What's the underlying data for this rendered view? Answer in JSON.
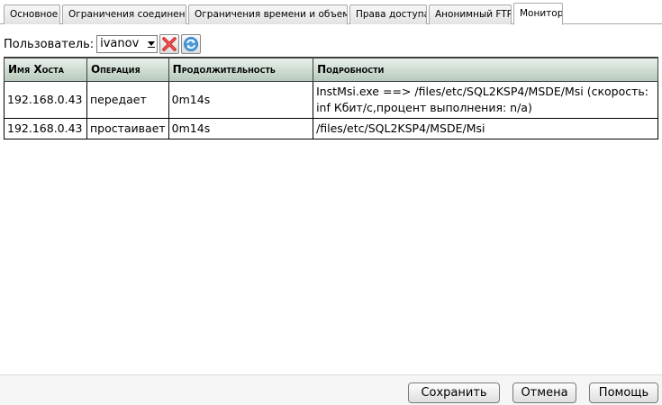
{
  "tabs": [
    {
      "label": "Основное",
      "active": false
    },
    {
      "label": "Ограничения соединений",
      "active": false
    },
    {
      "label": "Ограничения времени и объема",
      "active": false
    },
    {
      "label": "Права доступа",
      "active": false
    },
    {
      "label": "Анонимный FTP",
      "active": false
    },
    {
      "label": "Монитор",
      "active": true
    }
  ],
  "userbar": {
    "label": "Пользователь:",
    "selected_user": "ivanov",
    "delete_icon": "red-x-icon",
    "refresh_icon": "refresh-icon"
  },
  "table": {
    "columns": [
      "Имя Хоста",
      "Операция",
      "Продолжительность",
      "Подробности"
    ],
    "rows": [
      {
        "host": "192.168.0.43",
        "operation": "передает",
        "duration": "0m14s",
        "details": "InstMsi.exe ==> /files/etc/SQL2KSP4/MSDE/Msi (скорость: inf Кбит/с,процент выполнения: n/a)"
      },
      {
        "host": "192.168.0.43",
        "operation": "простаивает",
        "duration": "0m14s",
        "details": "/files/etc/SQL2KSP4/MSDE/Msi"
      }
    ]
  },
  "footer": {
    "save_label": "Сохранить",
    "cancel_label": "Отмена",
    "help_label": "Помощь"
  },
  "colors": {
    "header_gradient_top": "#e9f0ea",
    "header_gradient_bottom": "#b7c9bb",
    "delete_red": "#d42020",
    "refresh_blue": "#2f7fc7"
  }
}
